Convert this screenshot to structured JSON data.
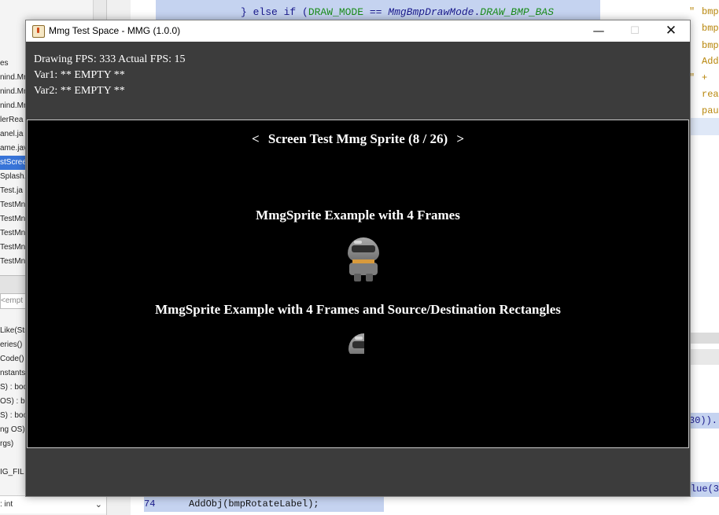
{
  "window": {
    "title": "Mmg Test Space - MMG (1.0.0)",
    "min_glyph": "—",
    "max_glyph": "☐",
    "close_glyph": "✕"
  },
  "hud": {
    "fps_line": "Drawing FPS: 333 Actual FPS: 15",
    "var1_line": "Var1: ** EMPTY **",
    "var2_line": "Var2: ** EMPTY **"
  },
  "screen": {
    "prev_arrow": "<",
    "title": "Screen Test Mmg Sprite (8 / 26)",
    "next_arrow": ">",
    "heading1": "MmgSprite Example with 4 Frames",
    "heading2": "MmgSprite Example with 4 Frames and Source/Destination Rectangles"
  },
  "ide": {
    "top_code_prefix": "} else if (",
    "top_code_const": "DRAW_MODE",
    "top_code_eq": " == ",
    "top_code_type": "MmgBmpDrawMode",
    "top_code_dot": ".",
    "top_code_member": "DRAW_BMP_BAS",
    "left_files": [
      "es",
      "nind.Mr",
      "nind.Mr",
      "nind.Mr",
      "lerRea",
      "anel.ja",
      "ame.jav",
      "stScree",
      "Splash.",
      "Test.ja",
      "TestMn",
      "TestMn",
      "TestMn",
      "TestMn",
      "TestMn"
    ],
    "left_selected_index": 7,
    "combo_text": "<empt",
    "left_members": [
      "Like(Str",
      "eries()",
      "Code()",
      "nstants",
      "S) : boo",
      "OS) : b",
      "S) : boo",
      "ng OS)",
      "rgs)",
      "",
      "IG_FIL"
    ],
    "bottom_member": ": int",
    "bottom_chevron": "⌄",
    "right_tokens": [
      "bmp",
      "bmp",
      "bmp",
      "Add",
      "+",
      "rea",
      "pau"
    ],
    "right_quotes": [
      "\"",
      "\""
    ],
    "right_blue_text": "30)).",
    "bottom_code_tail": "alue(3",
    "line_number": "74",
    "line_code": "AddObj(bmpRotateLabel);"
  }
}
